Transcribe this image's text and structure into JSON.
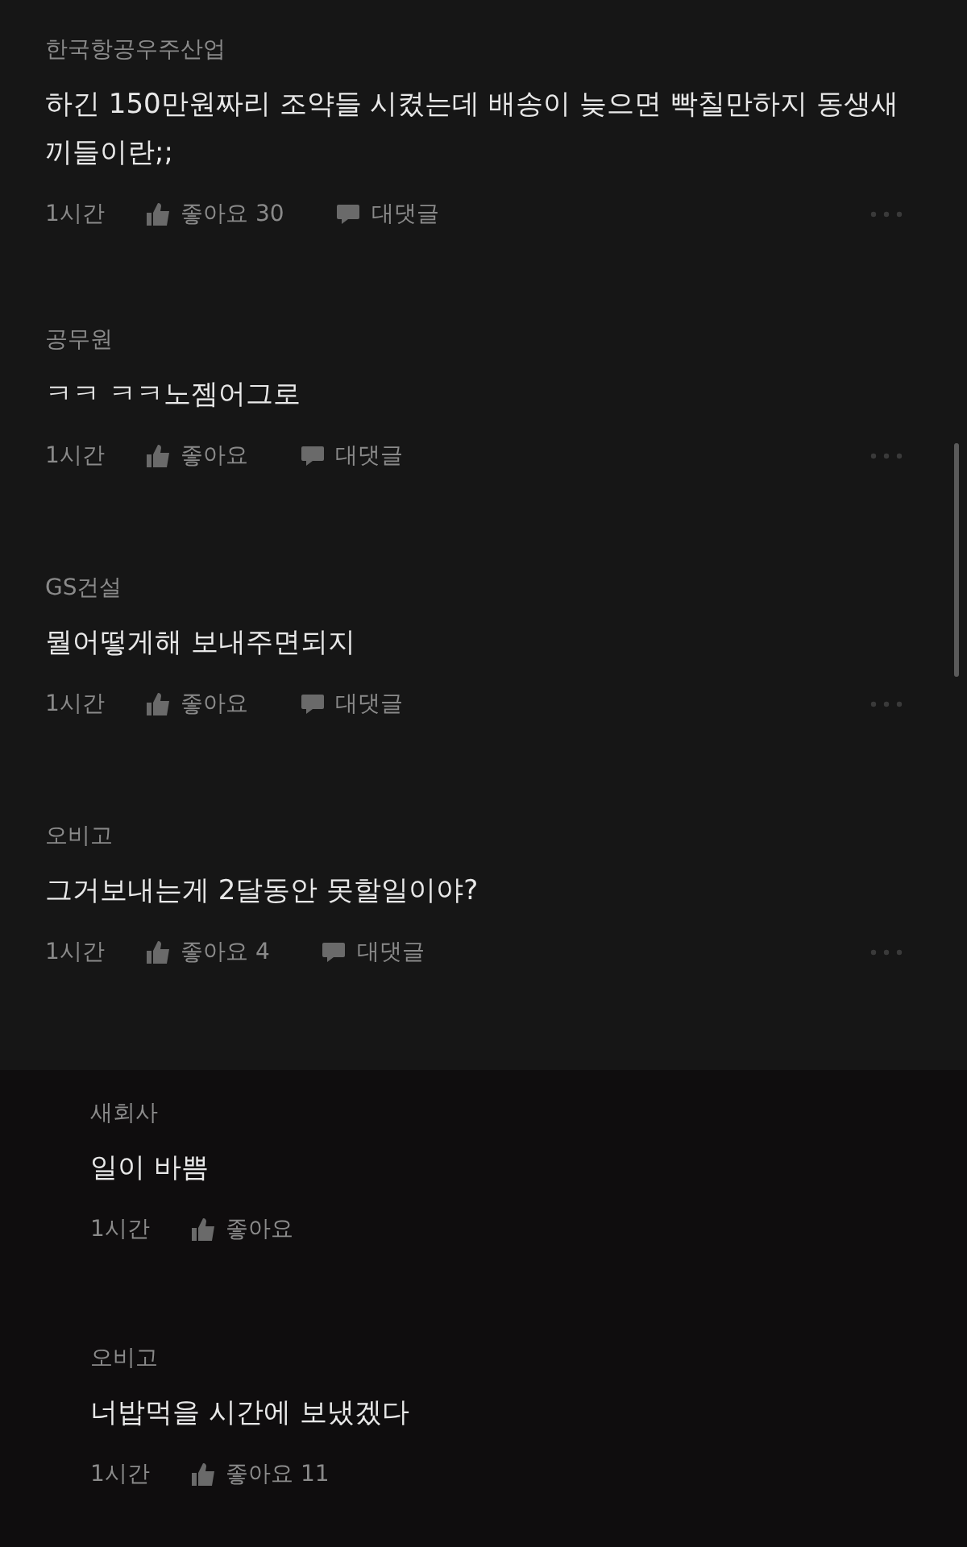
{
  "comments": [
    {
      "author": "한국항공우주산업",
      "body": "하긴 150만원짜리 조약들 시켰는데 배송이 늦으면 빡칠만하지 동생새끼들이란;;",
      "time": "1시간",
      "like": "좋아요 30",
      "reply": "대댓글"
    },
    {
      "author": "공무원",
      "body": "ㅋㅋ ㅋㅋ노젬어그로",
      "time": "1시간",
      "like": "좋아요",
      "reply": "대댓글"
    },
    {
      "author": "GS건설",
      "body": "뭘어떻게해 보내주면되지",
      "time": "1시간",
      "like": "좋아요",
      "reply": "대댓글"
    },
    {
      "author": "오비고",
      "body": "그거보내는게 2달동안 못할일이야?",
      "time": "1시간",
      "like": "좋아요 4",
      "reply": "대댓글"
    }
  ],
  "replies": [
    {
      "author": "새회사",
      "body": "일이 바쁨",
      "time": "1시간",
      "like": "좋아요"
    },
    {
      "author": "오비고",
      "body": "너밥먹을 시간에 보냈겠다",
      "time": "1시간",
      "like": "좋아요 11"
    }
  ]
}
